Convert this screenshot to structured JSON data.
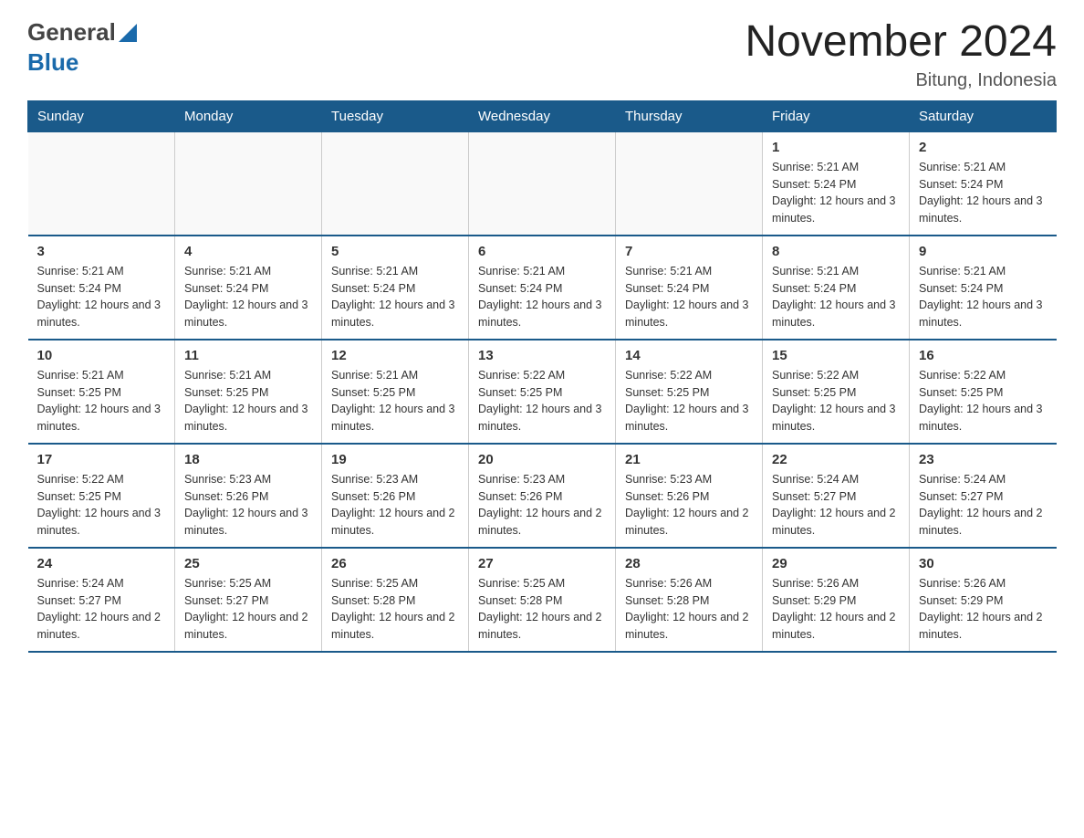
{
  "header": {
    "logo_general": "General",
    "logo_blue": "Blue",
    "month_title": "November 2024",
    "location": "Bitung, Indonesia"
  },
  "weekdays": [
    "Sunday",
    "Monday",
    "Tuesday",
    "Wednesday",
    "Thursday",
    "Friday",
    "Saturday"
  ],
  "weeks": [
    [
      {
        "day": "",
        "info": ""
      },
      {
        "day": "",
        "info": ""
      },
      {
        "day": "",
        "info": ""
      },
      {
        "day": "",
        "info": ""
      },
      {
        "day": "",
        "info": ""
      },
      {
        "day": "1",
        "info": "Sunrise: 5:21 AM\nSunset: 5:24 PM\nDaylight: 12 hours and 3 minutes."
      },
      {
        "day": "2",
        "info": "Sunrise: 5:21 AM\nSunset: 5:24 PM\nDaylight: 12 hours and 3 minutes."
      }
    ],
    [
      {
        "day": "3",
        "info": "Sunrise: 5:21 AM\nSunset: 5:24 PM\nDaylight: 12 hours and 3 minutes."
      },
      {
        "day": "4",
        "info": "Sunrise: 5:21 AM\nSunset: 5:24 PM\nDaylight: 12 hours and 3 minutes."
      },
      {
        "day": "5",
        "info": "Sunrise: 5:21 AM\nSunset: 5:24 PM\nDaylight: 12 hours and 3 minutes."
      },
      {
        "day": "6",
        "info": "Sunrise: 5:21 AM\nSunset: 5:24 PM\nDaylight: 12 hours and 3 minutes."
      },
      {
        "day": "7",
        "info": "Sunrise: 5:21 AM\nSunset: 5:24 PM\nDaylight: 12 hours and 3 minutes."
      },
      {
        "day": "8",
        "info": "Sunrise: 5:21 AM\nSunset: 5:24 PM\nDaylight: 12 hours and 3 minutes."
      },
      {
        "day": "9",
        "info": "Sunrise: 5:21 AM\nSunset: 5:24 PM\nDaylight: 12 hours and 3 minutes."
      }
    ],
    [
      {
        "day": "10",
        "info": "Sunrise: 5:21 AM\nSunset: 5:25 PM\nDaylight: 12 hours and 3 minutes."
      },
      {
        "day": "11",
        "info": "Sunrise: 5:21 AM\nSunset: 5:25 PM\nDaylight: 12 hours and 3 minutes."
      },
      {
        "day": "12",
        "info": "Sunrise: 5:21 AM\nSunset: 5:25 PM\nDaylight: 12 hours and 3 minutes."
      },
      {
        "day": "13",
        "info": "Sunrise: 5:22 AM\nSunset: 5:25 PM\nDaylight: 12 hours and 3 minutes."
      },
      {
        "day": "14",
        "info": "Sunrise: 5:22 AM\nSunset: 5:25 PM\nDaylight: 12 hours and 3 minutes."
      },
      {
        "day": "15",
        "info": "Sunrise: 5:22 AM\nSunset: 5:25 PM\nDaylight: 12 hours and 3 minutes."
      },
      {
        "day": "16",
        "info": "Sunrise: 5:22 AM\nSunset: 5:25 PM\nDaylight: 12 hours and 3 minutes."
      }
    ],
    [
      {
        "day": "17",
        "info": "Sunrise: 5:22 AM\nSunset: 5:25 PM\nDaylight: 12 hours and 3 minutes."
      },
      {
        "day": "18",
        "info": "Sunrise: 5:23 AM\nSunset: 5:26 PM\nDaylight: 12 hours and 3 minutes."
      },
      {
        "day": "19",
        "info": "Sunrise: 5:23 AM\nSunset: 5:26 PM\nDaylight: 12 hours and 2 minutes."
      },
      {
        "day": "20",
        "info": "Sunrise: 5:23 AM\nSunset: 5:26 PM\nDaylight: 12 hours and 2 minutes."
      },
      {
        "day": "21",
        "info": "Sunrise: 5:23 AM\nSunset: 5:26 PM\nDaylight: 12 hours and 2 minutes."
      },
      {
        "day": "22",
        "info": "Sunrise: 5:24 AM\nSunset: 5:27 PM\nDaylight: 12 hours and 2 minutes."
      },
      {
        "day": "23",
        "info": "Sunrise: 5:24 AM\nSunset: 5:27 PM\nDaylight: 12 hours and 2 minutes."
      }
    ],
    [
      {
        "day": "24",
        "info": "Sunrise: 5:24 AM\nSunset: 5:27 PM\nDaylight: 12 hours and 2 minutes."
      },
      {
        "day": "25",
        "info": "Sunrise: 5:25 AM\nSunset: 5:27 PM\nDaylight: 12 hours and 2 minutes."
      },
      {
        "day": "26",
        "info": "Sunrise: 5:25 AM\nSunset: 5:28 PM\nDaylight: 12 hours and 2 minutes."
      },
      {
        "day": "27",
        "info": "Sunrise: 5:25 AM\nSunset: 5:28 PM\nDaylight: 12 hours and 2 minutes."
      },
      {
        "day": "28",
        "info": "Sunrise: 5:26 AM\nSunset: 5:28 PM\nDaylight: 12 hours and 2 minutes."
      },
      {
        "day": "29",
        "info": "Sunrise: 5:26 AM\nSunset: 5:29 PM\nDaylight: 12 hours and 2 minutes."
      },
      {
        "day": "30",
        "info": "Sunrise: 5:26 AM\nSunset: 5:29 PM\nDaylight: 12 hours and 2 minutes."
      }
    ]
  ]
}
